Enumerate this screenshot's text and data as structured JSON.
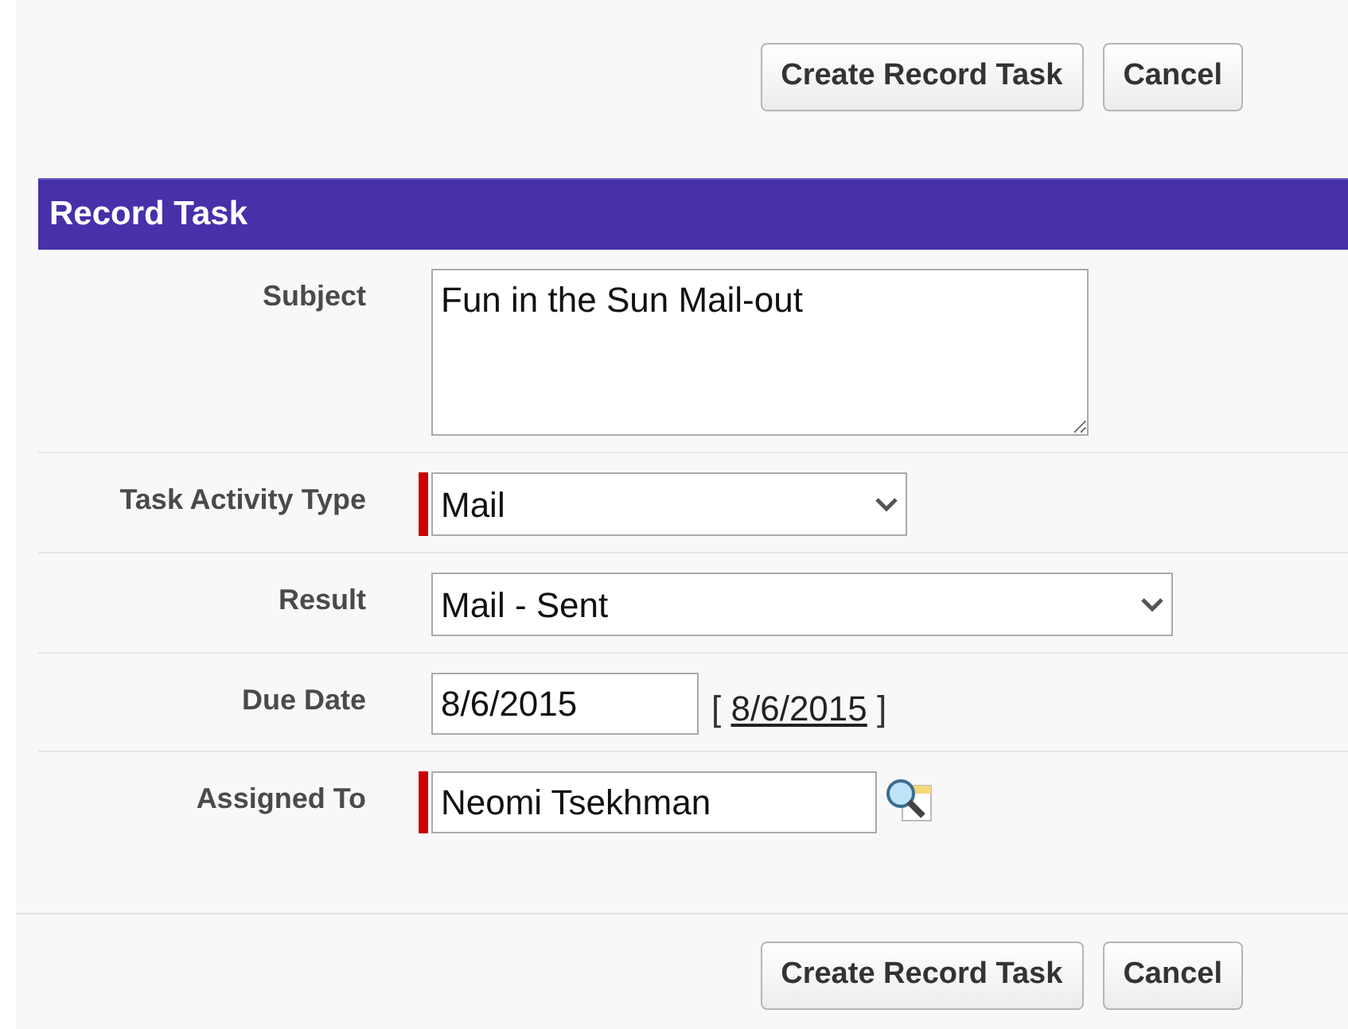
{
  "top_buttons": [
    "Create Record Task",
    "Cancel"
  ],
  "section": {
    "title": "Record Task"
  },
  "fields": [
    {
      "label": "Subject",
      "kind": "textarea",
      "required": false,
      "value": "Fun in the Sun Mail-out"
    },
    {
      "label": "Task Activity Type",
      "kind": "select",
      "required": true,
      "value": "Mail"
    },
    {
      "label": "Result",
      "kind": "select",
      "required": false,
      "value": "Mail - Sent",
      "wide": true
    },
    {
      "label": "Due Date",
      "kind": "date",
      "required": false,
      "value": "8/6/2015",
      "today": {
        "open": "[",
        "link": "8/6/2015",
        "close": "]"
      }
    },
    {
      "label": "Assigned To",
      "kind": "lookup",
      "required": true,
      "value": "Neomi Tsekhman"
    }
  ],
  "bottom_buttons": [
    "Create Record Task",
    "Cancel"
  ]
}
